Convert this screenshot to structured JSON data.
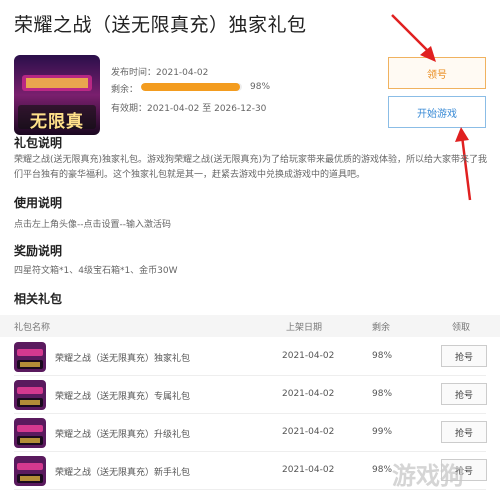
{
  "page": {
    "title": "荣耀之战（送无限真充）独家礼包",
    "cover_text": "无限真"
  },
  "meta": {
    "published_label": "发布时间：",
    "published": "2021-04-02",
    "remaining_label": "剩余：",
    "remaining_pct": "98%",
    "remaining_value": 0.98,
    "valid_label": "有效期：",
    "valid_from": "2021-04-02",
    "valid_sep": "至",
    "valid_to": "2026-12-30"
  },
  "actions": {
    "claim": "领号",
    "start": "开始游戏"
  },
  "sections": {
    "desc_title": "礼包说明",
    "desc_text": "荣耀之战(送无限真充)独家礼包。游戏狗荣耀之战(送无限真充)为了给玩家带来最优质的游戏体验，所以给大家带来了我们平台独有的豪华福利。这个独家礼包就是其一，赶紧去游戏中兑换成游戏中的道具吧。",
    "usage_title": "使用说明",
    "usage_text": "点击左上角头像--点击设置--输入激活码",
    "reward_title": "奖励说明",
    "reward_text": "四星符文箱*1、4级宝石箱*1、金币30W",
    "related_title": "相关礼包"
  },
  "table": {
    "headers": {
      "name": "礼包名称",
      "date": "上架日期",
      "remain": "剩余",
      "get": "领取"
    },
    "rows": [
      {
        "name": "荣耀之战（送无限真充）独家礼包",
        "date": "2021-04-02",
        "remain": "98%",
        "action": "抢号"
      },
      {
        "name": "荣耀之战（送无限真充）专属礼包",
        "date": "2021-04-02",
        "remain": "98%",
        "action": "抢号"
      },
      {
        "name": "荣耀之战（送无限真充）升级礼包",
        "date": "2021-04-02",
        "remain": "99%",
        "action": "抢号"
      },
      {
        "name": "荣耀之战（送无限真充）新手礼包",
        "date": "2021-04-02",
        "remain": "98%",
        "action": "抢号"
      }
    ]
  },
  "watermark": "游戏狗",
  "colors": {
    "accent_orange": "#f39c1f",
    "accent_blue": "#3a8bd6",
    "arrow_red": "#e02020"
  }
}
